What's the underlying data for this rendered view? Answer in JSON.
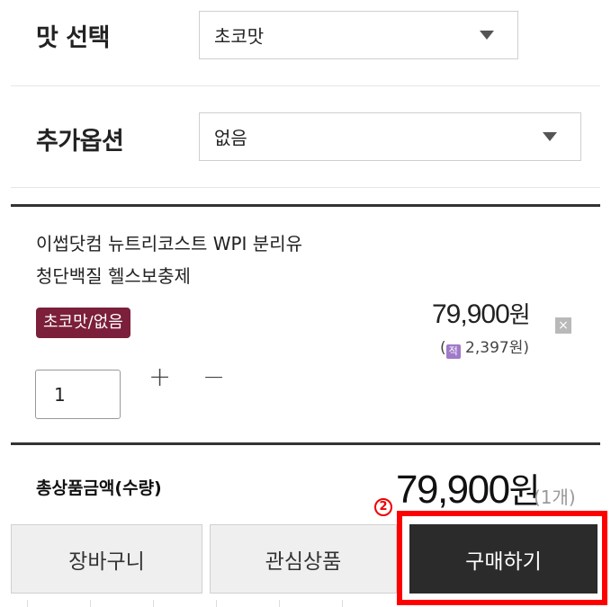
{
  "options": {
    "flavor": {
      "label": "맛 선택",
      "value": "초코맛"
    },
    "extra": {
      "label": "추가옵션",
      "value": "없음"
    }
  },
  "item": {
    "name_line1": "이썹닷컴 뉴트리코스트 WPI 분리유",
    "name_line2": "청단백질 헬스보충제",
    "option_badge": "초코맛/없음",
    "price": "79,900",
    "price_unit": "원",
    "points_open": "(",
    "points_icon_text": "적",
    "points_value": "2,397원)",
    "remove_symbol": "×",
    "quantity": "1",
    "plus_symbol": "+",
    "minus_symbol": "−"
  },
  "total": {
    "label": "총상품금액(수량)",
    "price": "79,900",
    "unit": "원",
    "count": "(1개)"
  },
  "annotation": {
    "marker": "2"
  },
  "buttons": {
    "cart": "장바구니",
    "wishlist": "관심상품",
    "buy": "구매하기"
  },
  "colors": {
    "badge_bg": "#7b1f3a",
    "buy_bg": "#2b2b2b",
    "highlight": "#ff0000",
    "points_icon": "#a07ac8"
  }
}
